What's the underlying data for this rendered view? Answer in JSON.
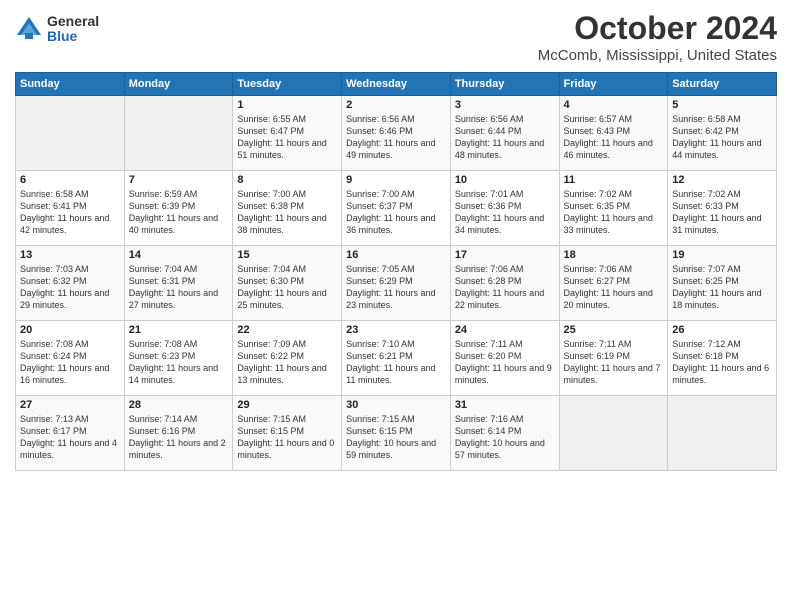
{
  "logo": {
    "general": "General",
    "blue": "Blue"
  },
  "title": "October 2024",
  "location": "McComb, Mississippi, United States",
  "days_header": [
    "Sunday",
    "Monday",
    "Tuesday",
    "Wednesday",
    "Thursday",
    "Friday",
    "Saturday"
  ],
  "weeks": [
    [
      {
        "num": "",
        "detail": ""
      },
      {
        "num": "",
        "detail": ""
      },
      {
        "num": "1",
        "detail": "Sunrise: 6:55 AM\nSunset: 6:47 PM\nDaylight: 11 hours and 51 minutes."
      },
      {
        "num": "2",
        "detail": "Sunrise: 6:56 AM\nSunset: 6:46 PM\nDaylight: 11 hours and 49 minutes."
      },
      {
        "num": "3",
        "detail": "Sunrise: 6:56 AM\nSunset: 6:44 PM\nDaylight: 11 hours and 48 minutes."
      },
      {
        "num": "4",
        "detail": "Sunrise: 6:57 AM\nSunset: 6:43 PM\nDaylight: 11 hours and 46 minutes."
      },
      {
        "num": "5",
        "detail": "Sunrise: 6:58 AM\nSunset: 6:42 PM\nDaylight: 11 hours and 44 minutes."
      }
    ],
    [
      {
        "num": "6",
        "detail": "Sunrise: 6:58 AM\nSunset: 6:41 PM\nDaylight: 11 hours and 42 minutes."
      },
      {
        "num": "7",
        "detail": "Sunrise: 6:59 AM\nSunset: 6:39 PM\nDaylight: 11 hours and 40 minutes."
      },
      {
        "num": "8",
        "detail": "Sunrise: 7:00 AM\nSunset: 6:38 PM\nDaylight: 11 hours and 38 minutes."
      },
      {
        "num": "9",
        "detail": "Sunrise: 7:00 AM\nSunset: 6:37 PM\nDaylight: 11 hours and 36 minutes."
      },
      {
        "num": "10",
        "detail": "Sunrise: 7:01 AM\nSunset: 6:36 PM\nDaylight: 11 hours and 34 minutes."
      },
      {
        "num": "11",
        "detail": "Sunrise: 7:02 AM\nSunset: 6:35 PM\nDaylight: 11 hours and 33 minutes."
      },
      {
        "num": "12",
        "detail": "Sunrise: 7:02 AM\nSunset: 6:33 PM\nDaylight: 11 hours and 31 minutes."
      }
    ],
    [
      {
        "num": "13",
        "detail": "Sunrise: 7:03 AM\nSunset: 6:32 PM\nDaylight: 11 hours and 29 minutes."
      },
      {
        "num": "14",
        "detail": "Sunrise: 7:04 AM\nSunset: 6:31 PM\nDaylight: 11 hours and 27 minutes."
      },
      {
        "num": "15",
        "detail": "Sunrise: 7:04 AM\nSunset: 6:30 PM\nDaylight: 11 hours and 25 minutes."
      },
      {
        "num": "16",
        "detail": "Sunrise: 7:05 AM\nSunset: 6:29 PM\nDaylight: 11 hours and 23 minutes."
      },
      {
        "num": "17",
        "detail": "Sunrise: 7:06 AM\nSunset: 6:28 PM\nDaylight: 11 hours and 22 minutes."
      },
      {
        "num": "18",
        "detail": "Sunrise: 7:06 AM\nSunset: 6:27 PM\nDaylight: 11 hours and 20 minutes."
      },
      {
        "num": "19",
        "detail": "Sunrise: 7:07 AM\nSunset: 6:25 PM\nDaylight: 11 hours and 18 minutes."
      }
    ],
    [
      {
        "num": "20",
        "detail": "Sunrise: 7:08 AM\nSunset: 6:24 PM\nDaylight: 11 hours and 16 minutes."
      },
      {
        "num": "21",
        "detail": "Sunrise: 7:08 AM\nSunset: 6:23 PM\nDaylight: 11 hours and 14 minutes."
      },
      {
        "num": "22",
        "detail": "Sunrise: 7:09 AM\nSunset: 6:22 PM\nDaylight: 11 hours and 13 minutes."
      },
      {
        "num": "23",
        "detail": "Sunrise: 7:10 AM\nSunset: 6:21 PM\nDaylight: 11 hours and 11 minutes."
      },
      {
        "num": "24",
        "detail": "Sunrise: 7:11 AM\nSunset: 6:20 PM\nDaylight: 11 hours and 9 minutes."
      },
      {
        "num": "25",
        "detail": "Sunrise: 7:11 AM\nSunset: 6:19 PM\nDaylight: 11 hours and 7 minutes."
      },
      {
        "num": "26",
        "detail": "Sunrise: 7:12 AM\nSunset: 6:18 PM\nDaylight: 11 hours and 6 minutes."
      }
    ],
    [
      {
        "num": "27",
        "detail": "Sunrise: 7:13 AM\nSunset: 6:17 PM\nDaylight: 11 hours and 4 minutes."
      },
      {
        "num": "28",
        "detail": "Sunrise: 7:14 AM\nSunset: 6:16 PM\nDaylight: 11 hours and 2 minutes."
      },
      {
        "num": "29",
        "detail": "Sunrise: 7:15 AM\nSunset: 6:15 PM\nDaylight: 11 hours and 0 minutes."
      },
      {
        "num": "30",
        "detail": "Sunrise: 7:15 AM\nSunset: 6:15 PM\nDaylight: 10 hours and 59 minutes."
      },
      {
        "num": "31",
        "detail": "Sunrise: 7:16 AM\nSunset: 6:14 PM\nDaylight: 10 hours and 57 minutes."
      },
      {
        "num": "",
        "detail": ""
      },
      {
        "num": "",
        "detail": ""
      }
    ]
  ]
}
